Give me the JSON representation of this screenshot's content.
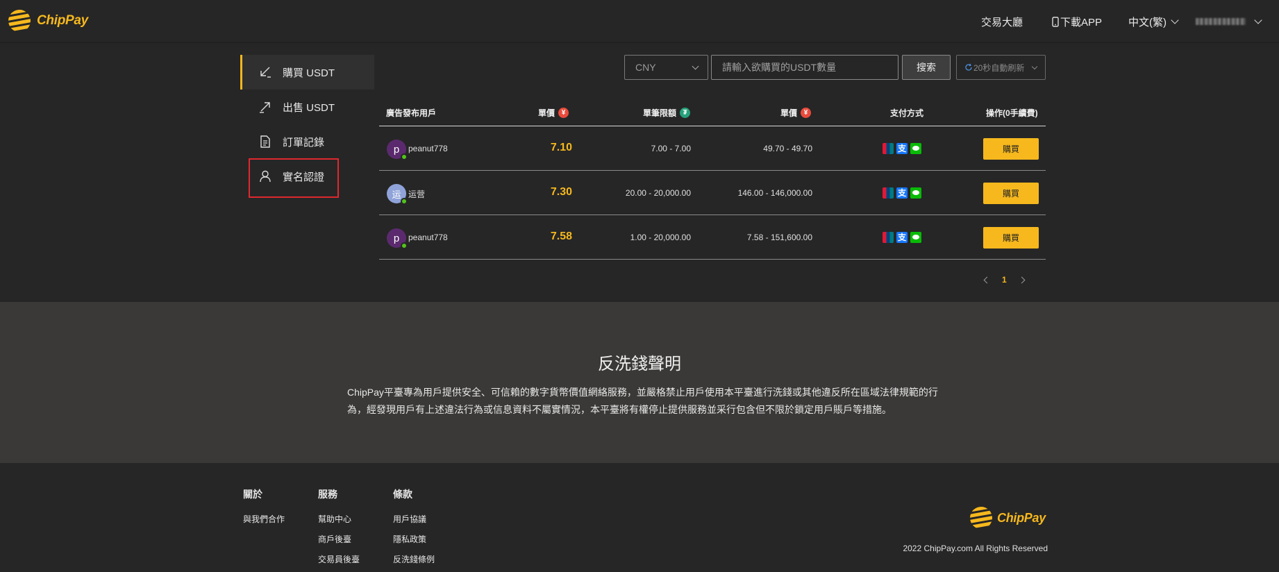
{
  "header": {
    "brand": "ChipPay",
    "nav_exchange": "交易大廳",
    "nav_download": "下載APP",
    "nav_language": "中文(繁)"
  },
  "sidebar": {
    "items": [
      {
        "label": "購買 USDT",
        "icon": "buy-arrow-icon",
        "active": true
      },
      {
        "label": "出售 USDT",
        "icon": "sell-arrow-icon",
        "active": false
      },
      {
        "label": "訂單記錄",
        "icon": "document-icon",
        "active": false
      },
      {
        "label": "實名認證",
        "icon": "user-icon",
        "active": false
      }
    ]
  },
  "toolbar": {
    "currency": "CNY",
    "quantity_placeholder": "請輸入欲購買的USDT數量",
    "search_label": "搜索",
    "refresh_label": "20秒自動刷新"
  },
  "table": {
    "headers": {
      "user": "廣告發布用戶",
      "unit_price": "單價",
      "limit": "單筆限額",
      "total": "單價",
      "payment": "支付方式",
      "action": "操作(0手續費)"
    },
    "rows": [
      {
        "avatar": "p",
        "avatar_color": "#5b2a6e",
        "user": "peanut778",
        "price": "7.10",
        "limit": "7.00 - 7.00",
        "total": "49.70 - 49.70",
        "payments": [
          "unionpay",
          "alipay",
          "wechat"
        ],
        "action": "購買"
      },
      {
        "avatar": "运",
        "avatar_color": "#8fa3d9",
        "user": "运营",
        "price": "7.30",
        "limit": "20.00 - 20,000.00",
        "total": "146.00 - 146,000.00",
        "payments": [
          "unionpay",
          "alipay",
          "wechat"
        ],
        "action": "購買"
      },
      {
        "avatar": "p",
        "avatar_color": "#5b2a6e",
        "user": "peanut778",
        "price": "7.58",
        "limit": "1.00 - 20,000.00",
        "total": "7.58 - 151,600.00",
        "payments": [
          "unionpay",
          "alipay",
          "wechat"
        ],
        "action": "購買"
      }
    ]
  },
  "pagination": {
    "current": "1"
  },
  "aml": {
    "title": "反洗錢聲明",
    "text": "ChipPay平臺專為用戶提供安全、可信賴的數字貨幣價值網絡服務，並嚴格禁止用戶使用本平臺進行洗錢或其他違反所在區域法律規範的行為，經發現用戶有上述違法行為或信息資料不屬實情況，本平臺將有權停止提供服務並采行包含但不限於鎖定用戶賬戶等措施。"
  },
  "footer": {
    "about": {
      "heading": "關於",
      "links": [
        "與我們合作"
      ]
    },
    "services": {
      "heading": "服務",
      "links": [
        "幫助中心",
        "商戶後臺",
        "交易員後臺"
      ]
    },
    "terms": {
      "heading": "條款",
      "links": [
        "用戶協議",
        "隱私政策",
        "反洗錢條例"
      ]
    },
    "brand": "ChipPay",
    "copyright": "2022 ChipPay.com All Rights Reserved"
  },
  "colors": {
    "accent": "#f6b81d",
    "highlight": "#e0282e"
  }
}
